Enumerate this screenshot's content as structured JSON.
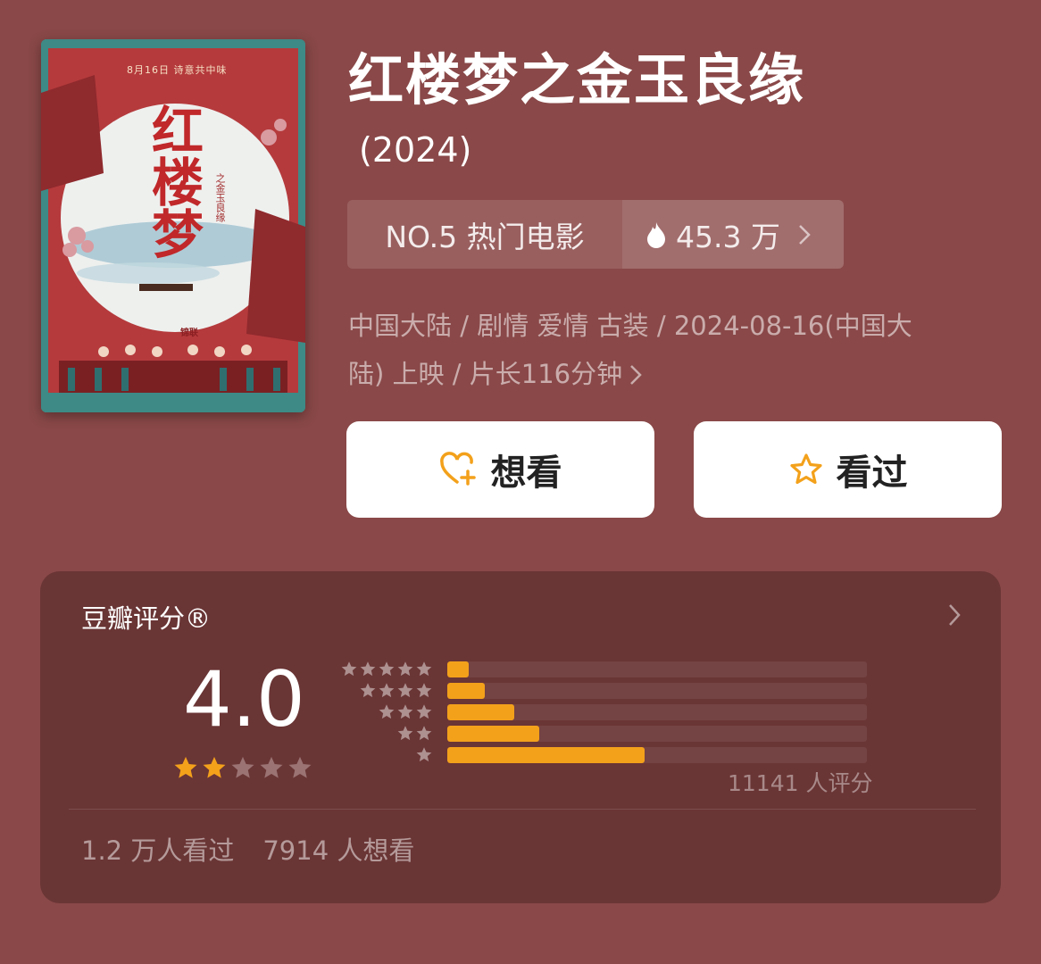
{
  "movie": {
    "title": "红楼梦之金玉良缘",
    "year": "(2024)",
    "poster": {
      "date_text": "8月16日 诗意共中味",
      "calligraphy": "红楼梦",
      "subtitle": "之金玉良缘",
      "studio": "锦联"
    }
  },
  "rank": {
    "label": "NO.5 热门电影",
    "heat": "45.3 万",
    "icon": "flame-icon"
  },
  "meta": {
    "line1": "中国大陆 / 剧情 爱情 古装 / 2024-08-16(中国大",
    "line2": "陆) 上映 / 片长116分钟"
  },
  "actions": {
    "want_label": "想看",
    "watched_label": "看过"
  },
  "rating": {
    "title": "豆瓣评分®",
    "score": "4.0",
    "stars_filled": 2,
    "stars_total": 5,
    "distribution": [
      {
        "stars": 5,
        "fraction": 0.05
      },
      {
        "stars": 4,
        "fraction": 0.09
      },
      {
        "stars": 3,
        "fraction": 0.16
      },
      {
        "stars": 2,
        "fraction": 0.22
      },
      {
        "stars": 1,
        "fraction": 0.47
      }
    ],
    "count": "11141 人评分",
    "watched": "1.2 万人看过",
    "wishlist": "7914 人想看"
  },
  "colors": {
    "background": "#8a4848",
    "card": "#6a3535",
    "accent": "#f3a11b",
    "star_empty": "#9b7373"
  }
}
